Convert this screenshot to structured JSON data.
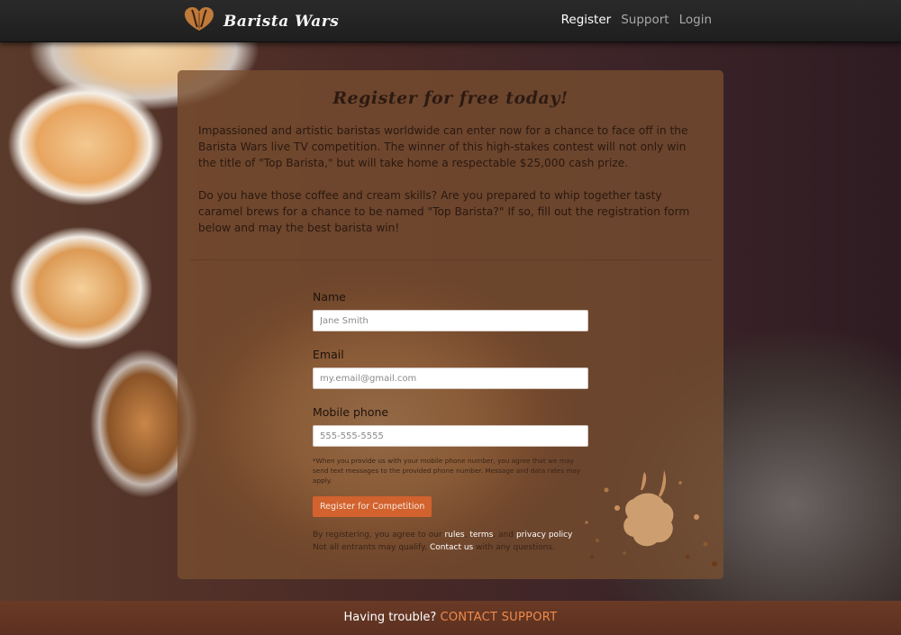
{
  "header": {
    "brand_title": "Barista Wars",
    "logo_icon": "coffee-bean-heart-icon",
    "nav": [
      {
        "label": "Register",
        "active": true
      },
      {
        "label": "Support",
        "active": false
      },
      {
        "label": "Login",
        "active": false
      }
    ]
  },
  "panel": {
    "title": "Register for free today!",
    "intro_1": "Impassioned and artistic baristas worldwide can enter now for a chance to face off in the Barista Wars live TV competition. The winner of this high-stakes contest will not only win the title of \"Top Barista,\" but will take home a respectable $25,000 cash prize.",
    "intro_2": "Do you have those coffee and cream skills? Are you prepared to whip together tasty caramel brews for a chance to be named \"Top Barista?\" If so, fill out the registration form below and may the best barista win!"
  },
  "form": {
    "name_label": "Name",
    "name_placeholder": "Jane Smith",
    "email_label": "Email",
    "email_placeholder": "my.email@gmail.com",
    "phone_label": "Mobile phone",
    "phone_placeholder": "555-555-5555",
    "disclaimer": "*When you provide us with your mobile phone number, you agree that we may send text messages to the provided phone number. Message and data rates may apply.",
    "submit_label": "Register for Competition",
    "terms_prefix": "By registering, you agree to our",
    "rules_link": "rules",
    "terms_link": "terms",
    "terms_and": "and",
    "privacy_link": "privacy policy",
    "qualify_text": "Not all entrants may qualify.",
    "contact_link": "Contact us",
    "questions_text": "with any questions."
  },
  "footer": {
    "trouble_text": "Having trouble?",
    "contact_support": "CONTACT SUPPORT"
  },
  "colors": {
    "accent": "#d2622e",
    "footer_link": "#f08a4a",
    "navbar": "#222222"
  }
}
